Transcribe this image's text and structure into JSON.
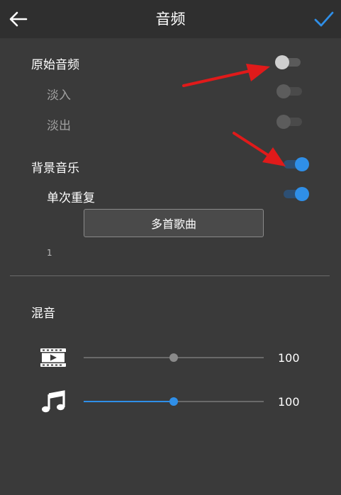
{
  "header": {
    "title": "音频",
    "back_icon": "arrow-left-icon",
    "confirm_icon": "checkmark-icon"
  },
  "original_audio": {
    "label": "原始音频",
    "enabled": false,
    "fade_in": {
      "label": "淡入",
      "enabled": false
    },
    "fade_out": {
      "label": "淡出",
      "enabled": false
    }
  },
  "background_music": {
    "label": "背景音乐",
    "enabled": true,
    "repeat_once": {
      "label": "单次重复",
      "enabled": true
    },
    "multi_song_button": "多首歌曲",
    "track_count": "1"
  },
  "mix": {
    "label": "混音",
    "video": {
      "icon": "video-film-icon",
      "value": "100",
      "level": 0.5
    },
    "music": {
      "icon": "music-note-icon",
      "value": "100",
      "level": 0.5
    }
  },
  "colors": {
    "accent": "#2f8fe8",
    "arrow": "#e01a1a",
    "background": "#3a3a3a",
    "header": "#2f2f2f"
  }
}
